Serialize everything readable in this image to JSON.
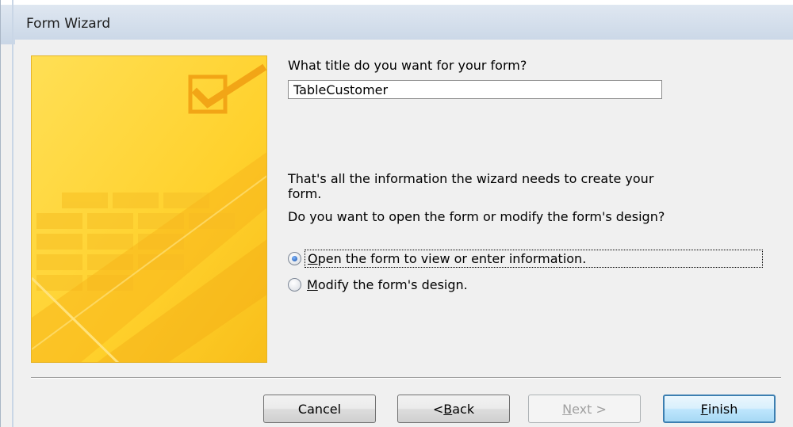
{
  "window": {
    "title": "Form Wizard"
  },
  "form": {
    "title_prompt": "What title do you want for your form?",
    "title_value": "TableCustomer",
    "info_line1": "That's all the information the wizard needs to create your",
    "info_line2": "form.",
    "question": "Do you want to open the form or modify the form's design?",
    "options": [
      {
        "accel": "O",
        "rest": "pen the form to view or enter information.",
        "checked": true
      },
      {
        "accel": "M",
        "rest": "odify the form's design.",
        "checked": false
      }
    ]
  },
  "buttons": {
    "cancel": "Cancel",
    "back_prefix": "< ",
    "back_accel": "B",
    "back_rest": "ack",
    "next_accel": "N",
    "next_rest": "ext >",
    "finish_accel": "F",
    "finish_rest": "inish"
  },
  "colors": {
    "art_yellow": "#ffd23a",
    "art_orange": "#f6b81c",
    "default_button_border": "#3c7fb1"
  },
  "icons": {
    "art": "checkbox-table-icon"
  }
}
